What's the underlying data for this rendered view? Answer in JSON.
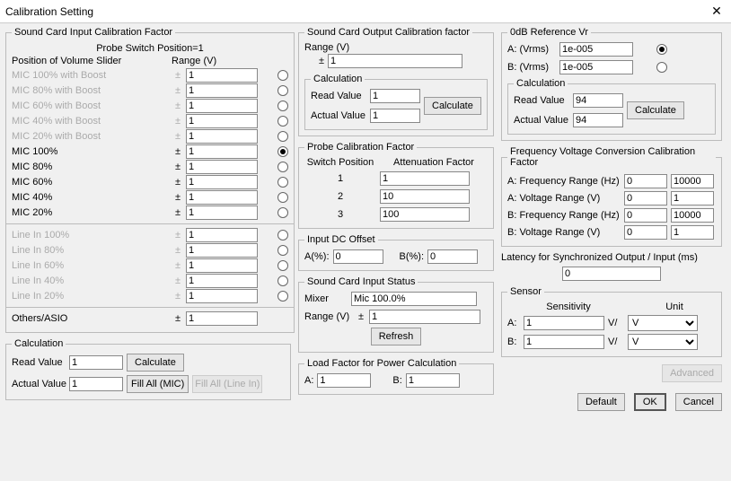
{
  "window": {
    "title": "Calibration Setting"
  },
  "input_cal": {
    "legend": "Sound Card Input Calibration Factor",
    "subtitle": "Probe Switch Position=1",
    "col1": "Position of Volume Slider",
    "col2": "Range (V)",
    "rows": [
      {
        "label": "MIC 100% with Boost",
        "val": "1",
        "enabled": false,
        "selected": false
      },
      {
        "label": "MIC 80% with Boost",
        "val": "1",
        "enabled": false,
        "selected": false
      },
      {
        "label": "MIC 60% with Boost",
        "val": "1",
        "enabled": false,
        "selected": false
      },
      {
        "label": "MIC 40% with Boost",
        "val": "1",
        "enabled": false,
        "selected": false
      },
      {
        "label": "MIC 20% with Boost",
        "val": "1",
        "enabled": false,
        "selected": false
      },
      {
        "label": "MIC 100%",
        "val": "1",
        "enabled": true,
        "selected": true
      },
      {
        "label": "MIC 80%",
        "val": "1",
        "enabled": true,
        "selected": false
      },
      {
        "label": "MIC 60%",
        "val": "1",
        "enabled": true,
        "selected": false
      },
      {
        "label": "MIC 40%",
        "val": "1",
        "enabled": true,
        "selected": false
      },
      {
        "label": "MIC 20%",
        "val": "1",
        "enabled": true,
        "selected": false
      }
    ],
    "line_rows": [
      {
        "label": "Line In 100%",
        "val": "1",
        "enabled": false,
        "selected": false
      },
      {
        "label": "Line In 80%",
        "val": "1",
        "enabled": false,
        "selected": false
      },
      {
        "label": "Line In 60%",
        "val": "1",
        "enabled": false,
        "selected": false
      },
      {
        "label": "Line In 40%",
        "val": "1",
        "enabled": false,
        "selected": false
      },
      {
        "label": "Line In 20%",
        "val": "1",
        "enabled": false,
        "selected": false
      }
    ],
    "others_label": "Others/ASIO",
    "others_val": "1",
    "calc": {
      "legend": "Calculation",
      "read_label": "Read Value",
      "read_val": "1",
      "actual_label": "Actual Value",
      "actual_val": "1",
      "calc_btn": "Calculate",
      "fill_mic": "Fill All (MIC)",
      "fill_line": "Fill All (Line In)"
    }
  },
  "output_cal": {
    "legend": "Sound Card Output Calibration factor",
    "range_label": "Range (V)",
    "pm": "±",
    "range_val": "1",
    "calc": {
      "legend": "Calculation",
      "read_label": "Read Value",
      "read_val": "1",
      "actual_label": "Actual Value",
      "actual_val": "1",
      "calc_btn": "Calculate"
    }
  },
  "probe": {
    "legend": "Probe Calibration Factor",
    "c1": "Switch Position",
    "c2": "Attenuation Factor",
    "rows": [
      {
        "pos": "1",
        "val": "1"
      },
      {
        "pos": "2",
        "val": "10"
      },
      {
        "pos": "3",
        "val": "100"
      }
    ]
  },
  "dc_offset": {
    "legend": "Input DC Offset",
    "a_label": "A(%):",
    "a_val": "0",
    "b_label": "B(%):",
    "b_val": "0"
  },
  "input_status": {
    "legend": "Sound Card Input Status",
    "mixer_label": "Mixer",
    "mixer_val": "Mic 100.0%",
    "range_label": "Range (V)",
    "pm": "±",
    "range_val": "1",
    "refresh_btn": "Refresh"
  },
  "load_factor": {
    "legend": "Load Factor for Power Calculation",
    "a_label": "A:",
    "a_val": "1",
    "b_label": "B:",
    "b_val": "1"
  },
  "ref_vr": {
    "legend": "0dB Reference Vr",
    "a_label": "A: (Vrms)",
    "a_val": "1e-005",
    "b_label": "B: (Vrms)",
    "b_val": "1e-005",
    "calc": {
      "legend": "Calculation",
      "read_label": "Read Value",
      "read_val": "94",
      "actual_label": "Actual Value",
      "actual_val": "94",
      "calc_btn": "Calculate"
    }
  },
  "freq_volt": {
    "legend": "Frequency Voltage Conversion Calibration Factor",
    "rows": [
      {
        "label": "A: Frequency Range (Hz)",
        "v1": "0",
        "v2": "10000"
      },
      {
        "label": "A: Voltage Range (V)",
        "v1": "0",
        "v2": "1"
      },
      {
        "label": "B: Frequency Range (Hz)",
        "v1": "0",
        "v2": "10000"
      },
      {
        "label": "B: Voltage Range (V)",
        "v1": "0",
        "v2": "1"
      }
    ]
  },
  "latency": {
    "label": "Latency for Synchronized Output / Input (ms)",
    "val": "0"
  },
  "sensor": {
    "legend": "Sensor",
    "c1": "Sensitivity",
    "c2": "Unit",
    "rows": [
      {
        "label": "A:",
        "sens": "1",
        "vper": "V/",
        "unit": "V"
      },
      {
        "label": "B:",
        "sens": "1",
        "vper": "V/",
        "unit": "V"
      }
    ]
  },
  "buttons": {
    "advanced": "Advanced",
    "default": "Default",
    "ok": "OK",
    "cancel": "Cancel"
  }
}
